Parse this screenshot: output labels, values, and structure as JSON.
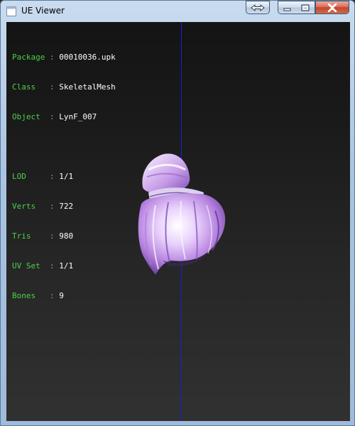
{
  "window": {
    "title": "UE Viewer",
    "buttons": {
      "swap": "swap-arrows-icon",
      "minimize": "minimize-icon",
      "maximize": "maximize-icon",
      "close": "close-icon"
    }
  },
  "info": {
    "group1": [
      {
        "label": "Package",
        "value": "00010036.upk"
      },
      {
        "label": "Class  ",
        "value": "SkeletalMesh"
      },
      {
        "label": "Object ",
        "value": "LynF_007"
      }
    ],
    "group2": [
      {
        "label": "LOD    ",
        "value": "1/1"
      },
      {
        "label": "Verts  ",
        "value": "722"
      },
      {
        "label": "Tris   ",
        "value": "980"
      },
      {
        "label": "UV Set ",
        "value": "1/1"
      },
      {
        "label": "Bones  ",
        "value": "9"
      }
    ],
    "separator": " : "
  },
  "colors": {
    "label": "#4ccf4c",
    "value": "#ffffff",
    "axis": "#1a1fd6",
    "mesh_primary": "#c89ae6",
    "mesh_highlight": "#ffffff"
  }
}
